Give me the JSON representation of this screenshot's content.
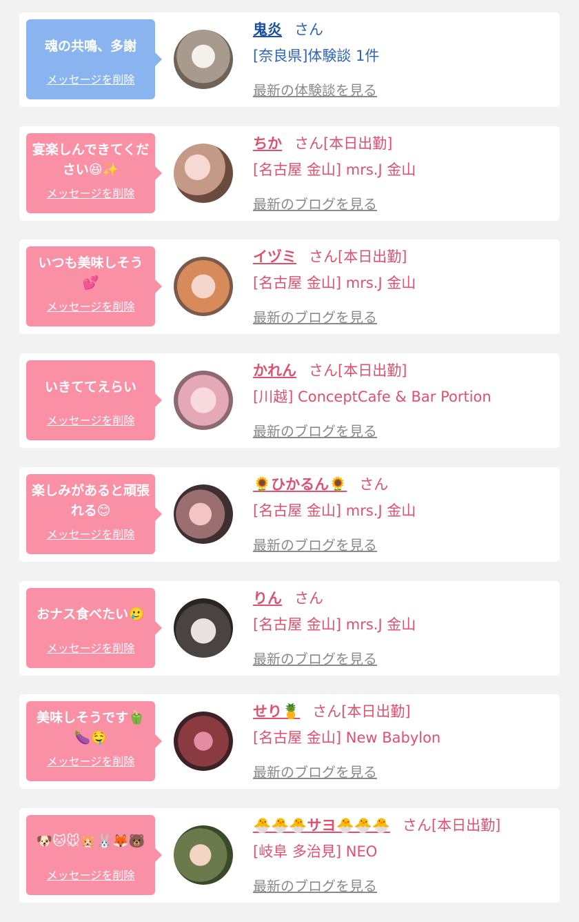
{
  "colors": {
    "page_background": "#f2f2f2",
    "card_background": "#ffffff",
    "bubble_blue": "#8ab4f0",
    "bubble_pink": "#f990a5",
    "text_blue": "#2b64b8",
    "text_pink": "#e0506e",
    "link_gray": "#8a8a8a"
  },
  "items": [
    {
      "theme": "blue",
      "message": "魂の共鳴、多謝",
      "delete_label": "メッセージを削除",
      "name": "鬼炎",
      "suffix": "さん",
      "detail": "[奈良県]体験談 1件",
      "link": "最新の体験談を見る",
      "avatar_icon": "clock-photo-icon"
    },
    {
      "theme": "pink",
      "message": "宴楽しんできてください😆✨",
      "delete_label": "メッセージを削除",
      "name": "ちか",
      "suffix": "さん[本日出勤]",
      "detail": "[名古屋 金山] mrs.J 金山",
      "link": "最新のブログを見る",
      "avatar_icon": "profile-photo-icon"
    },
    {
      "theme": "pink",
      "message": "いつも美味しそう💕",
      "delete_label": "メッセージを削除",
      "name": "イヅミ",
      "suffix": "さん[本日出勤]",
      "detail": "[名古屋 金山] mrs.J 金山",
      "link": "最新のブログを見る",
      "avatar_icon": "profile-photo-icon"
    },
    {
      "theme": "pink",
      "message": "いきててえらい",
      "delete_label": "メッセージを削除",
      "name": "かれん",
      "suffix": "さん[本日出勤]",
      "detail": "[川越] ConceptCafe & Bar Portion",
      "link": "最新のブログを見る",
      "avatar_icon": "profile-photo-icon"
    },
    {
      "theme": "pink",
      "message": "楽しみがあると頑張れる😊",
      "delete_label": "メッセージを削除",
      "name": "🌻ひかるん🌻",
      "suffix": "さん",
      "detail": "[名古屋 金山] mrs.J 金山",
      "link": "最新のブログを見る",
      "avatar_icon": "profile-photo-icon"
    },
    {
      "theme": "pink",
      "message": "おナス食べたい🥲",
      "delete_label": "メッセージを削除",
      "name": "りん",
      "suffix": "さん",
      "detail": "[名古屋 金山] mrs.J 金山",
      "link": "最新のブログを見る",
      "avatar_icon": "profile-photo-icon"
    },
    {
      "theme": "pink",
      "message": "美味しそうです🫑🍆🤤",
      "delete_label": "メッセージを削除",
      "name": "せり🍍",
      "suffix": "さん[本日出勤]",
      "detail": "[名古屋 金山] New Babylon",
      "link": "最新のブログを見る",
      "avatar_icon": "profile-photo-icon"
    },
    {
      "theme": "pink",
      "message": "🐶🐱🐭🐹🐰🦊🐻",
      "delete_label": "メッセージを削除",
      "name": "🐣🐣🐣サヨ🐣🐣🐣",
      "suffix": "さん[本日出勤]",
      "detail": "[岐阜 多治見] NEO",
      "link": "最新のブログを見る",
      "avatar_icon": "profile-photo-icon"
    }
  ]
}
